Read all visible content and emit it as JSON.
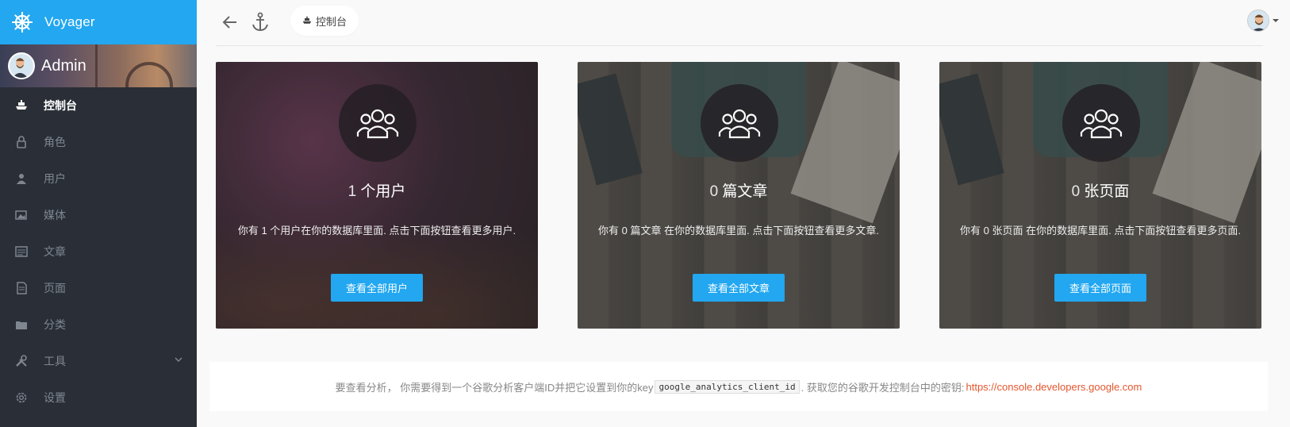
{
  "brand": {
    "name": "Voyager"
  },
  "profile": {
    "name": "Admin"
  },
  "sidebar": {
    "items": [
      {
        "label": "控制台",
        "icon": "boat-icon",
        "active": true
      },
      {
        "label": "角色",
        "icon": "lock-icon"
      },
      {
        "label": "用户",
        "icon": "person-icon"
      },
      {
        "label": "媒体",
        "icon": "images-icon"
      },
      {
        "label": "文章",
        "icon": "news-icon"
      },
      {
        "label": "页面",
        "icon": "file-text-icon"
      },
      {
        "label": "分类",
        "icon": "folder-icon"
      },
      {
        "label": "工具",
        "icon": "tools-icon",
        "has_children": true
      },
      {
        "label": "设置",
        "icon": "gear-icon"
      }
    ]
  },
  "topbar": {
    "breadcrumb": "控制台"
  },
  "cards": [
    {
      "count": "1",
      "unit": "个用户",
      "description": "你有 1 个用户在你的数据库里面. 点击下面按钮查看更多用户.",
      "button": "查看全部用户"
    },
    {
      "count": "0",
      "unit": "篇文章",
      "description": "你有 0 篇文章 在你的数据库里面. 点击下面按钮查看更多文章.",
      "button": "查看全部文章"
    },
    {
      "count": "0",
      "unit": "张页面",
      "description": "你有 0 张页面 在你的数据库里面. 点击下面按钮查看更多页面.",
      "button": "查看全部页面"
    }
  ],
  "analytics": {
    "text_before": "要查看分析， 你需要得到一个谷歌分析客户端ID并把它设置到你的key",
    "code": "google_analytics_client_id",
    "text_after": ". 获取您的谷歌开发控制台中的密钥: ",
    "link": "https://console.developers.google.com"
  },
  "colors": {
    "accent": "#22a7f0",
    "sidebar_bg": "#2a2f37",
    "link": "#e4572e"
  }
}
